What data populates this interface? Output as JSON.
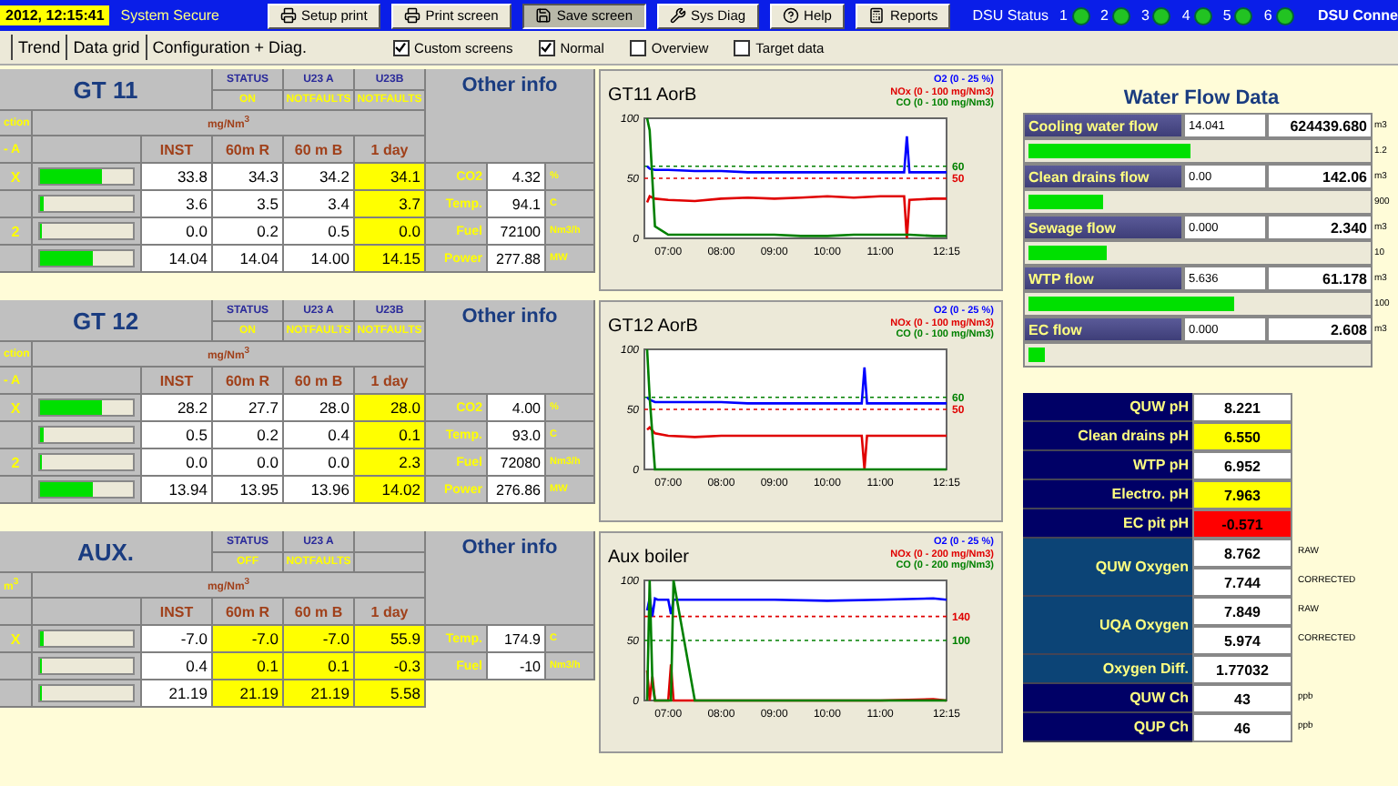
{
  "top_bar": {
    "datetime": "2012, 12:15:41",
    "system_state": "System Secure",
    "buttons": [
      {
        "label": "Setup print",
        "pressed": false
      },
      {
        "label": "Print screen",
        "pressed": false
      },
      {
        "label": "Save screen",
        "pressed": true
      },
      {
        "label": "Sys Diag",
        "pressed": false
      },
      {
        "label": "Help",
        "pressed": false
      },
      {
        "label": "Reports",
        "pressed": false
      }
    ],
    "dsu_status": {
      "label": "DSU Status",
      "units": [
        {
          "number": "1",
          "ok": true
        },
        {
          "number": "2",
          "ok": true
        },
        {
          "number": "3",
          "ok": true
        },
        {
          "number": "4",
          "ok": true
        },
        {
          "number": "5",
          "ok": true
        },
        {
          "number": "6",
          "ok": true
        }
      ]
    },
    "connection": "DSU Conne"
  },
  "tabs": [
    {
      "label": "Trend",
      "selected": false
    },
    {
      "label": "Data grid",
      "selected": false
    },
    {
      "label": "Configuration + Diag.",
      "selected": false
    }
  ],
  "options": [
    {
      "label": "Custom screens",
      "checked": true
    },
    {
      "label": "Normal",
      "checked": true
    },
    {
      "label": "Overview",
      "checked": false
    },
    {
      "label": "Target data",
      "checked": false
    }
  ],
  "blocks": [
    {
      "title": "GT 11",
      "status_columns": [
        {
          "header": "STATUS",
          "value": "ON"
        },
        {
          "header": "U23 A",
          "value": "NOTFAULTS"
        },
        {
          "header": "U23B",
          "value": "NOTFAULTS"
        }
      ],
      "unit_label": "ction",
      "unit": "mg/Nm$^{3}$",
      "columns_label": "- A",
      "columns": [
        "INST",
        "60m R",
        "60 m B",
        "1 day"
      ],
      "rows": [
        {
          "label": "X",
          "level": 0.67,
          "values": [
            {
              "text": "33.8",
              "highlighted": false
            },
            {
              "text": "34.3",
              "highlighted": false
            },
            {
              "text": "34.2",
              "highlighted": false
            },
            {
              "text": "34.1",
              "highlighted": true
            }
          ]
        },
        {
          "level": 0.04,
          "values": [
            {
              "text": "3.6",
              "highlighted": false
            },
            {
              "text": "3.5",
              "highlighted": false
            },
            {
              "text": "3.4",
              "highlighted": false
            },
            {
              "text": "3.7",
              "highlighted": true
            }
          ]
        },
        {
          "label": "2",
          "level": 0.02,
          "values": [
            {
              "text": "0.0",
              "highlighted": false
            },
            {
              "text": "0.2",
              "highlighted": false
            },
            {
              "text": "0.5",
              "highlighted": false
            },
            {
              "text": "0.0",
              "highlighted": true
            }
          ]
        },
        {
          "level": 0.57,
          "values": [
            {
              "text": "14.04",
              "highlighted": false
            },
            {
              "text": "14.04",
              "highlighted": false
            },
            {
              "text": "14.00",
              "highlighted": false
            },
            {
              "text": "14.15",
              "highlighted": true
            }
          ]
        }
      ],
      "other_info": {
        "title": "Other info",
        "items": [
          {
            "label": "CO2",
            "value": "4.32",
            "unit": "%"
          },
          {
            "label": "Temp.",
            "value": "94.1",
            "unit": "C"
          },
          {
            "label": "Fuel",
            "value": "72100",
            "unit": "Nm3/h"
          },
          {
            "label": "Power",
            "value": "277.88",
            "unit": "MW"
          }
        ]
      },
      "chart": {
        "title": "GT11 AorB",
        "chart_data": {
          "type": "line",
          "x": [
            6.6,
            6.65,
            6.75,
            7,
            7.5,
            8,
            8.5,
            9,
            9.5,
            10,
            10.5,
            11,
            11.45,
            11.5,
            11.55,
            12,
            12.25
          ],
          "series": [
            {
              "name": "O2 (0 - 25 %)",
              "color": "#0000ff",
              "values": [
                60,
                58,
                57,
                57,
                56,
                56,
                55,
                55,
                55,
                55,
                55,
                55,
                55,
                85,
                55,
                55,
                55
              ]
            },
            {
              "name": "NOx (0 - 100 mg/Nm3)",
              "color": "#e00000",
              "values": [
                30,
                35,
                33,
                32,
                31,
                33,
                34,
                33,
                34,
                35,
                34,
                35,
                35,
                0,
                32,
                33,
                33
              ]
            },
            {
              "name": "CO (0 - 100 mg/Nm3)",
              "color": "#008000",
              "values": [
                100,
                90,
                10,
                3,
                3,
                3,
                3,
                3,
                2,
                2,
                3,
                3,
                3,
                3,
                3,
                2,
                2
              ]
            }
          ],
          "xlim": [
            6.55,
            12.25
          ],
          "ylim": [
            0,
            100
          ],
          "xticks": [
            {
              "value": 7,
              "label": "07:00"
            },
            {
              "value": 8,
              "label": "08:00"
            },
            {
              "value": 9,
              "label": "09:00"
            },
            {
              "value": 10,
              "label": "10:00"
            },
            {
              "value": 11,
              "label": "11:00"
            },
            {
              "value": 12.25,
              "label": "12:15"
            }
          ],
          "yticks": [
            0,
            50,
            100
          ],
          "ref_lines": [
            {
              "axis": "y",
              "value": 60,
              "color": "#008000"
            },
            {
              "axis": "y",
              "value": 50,
              "color": "#e00000"
            }
          ]
        },
        "limit_labels": [
          "60",
          "50"
        ]
      }
    },
    {
      "title": "GT 12",
      "status_columns": [
        {
          "header": "STATUS",
          "value": "ON"
        },
        {
          "header": "U23 A",
          "value": "NOTFAULTS"
        },
        {
          "header": "U23B",
          "value": "NOTFAULTS"
        }
      ],
      "unit_label": "ction",
      "unit": "mg/Nm$^{3}$",
      "columns_label": "- A",
      "columns": [
        "INST",
        "60m R",
        "60 m B",
        "1 day"
      ],
      "rows": [
        {
          "label": "X",
          "level": 0.67,
          "values": [
            {
              "text": "28.2",
              "highlighted": false
            },
            {
              "text": "27.7",
              "highlighted": false
            },
            {
              "text": "28.0",
              "highlighted": false
            },
            {
              "text": "28.0",
              "highlighted": true
            }
          ]
        },
        {
          "level": 0.04,
          "values": [
            {
              "text": "0.5",
              "highlighted": false
            },
            {
              "text": "0.2",
              "highlighted": false
            },
            {
              "text": "0.4",
              "highlighted": false
            },
            {
              "text": "0.1",
              "highlighted": true
            }
          ]
        },
        {
          "label": "2",
          "level": 0.02,
          "values": [
            {
              "text": "0.0",
              "highlighted": false
            },
            {
              "text": "0.0",
              "highlighted": false
            },
            {
              "text": "0.0",
              "highlighted": false
            },
            {
              "text": "2.3",
              "highlighted": true
            }
          ]
        },
        {
          "level": 0.57,
          "values": [
            {
              "text": "13.94",
              "highlighted": false
            },
            {
              "text": "13.95",
              "highlighted": false
            },
            {
              "text": "13.96",
              "highlighted": false
            },
            {
              "text": "14.02",
              "highlighted": true
            }
          ]
        }
      ],
      "other_info": {
        "title": "Other info",
        "items": [
          {
            "label": "CO2",
            "value": "4.00",
            "unit": "%"
          },
          {
            "label": "Temp.",
            "value": "93.0",
            "unit": "C"
          },
          {
            "label": "Fuel",
            "value": "72080",
            "unit": "Nm3/h"
          },
          {
            "label": "Power",
            "value": "276.86",
            "unit": "MW"
          }
        ]
      },
      "chart": {
        "title": "GT12 AorB",
        "chart_data": {
          "type": "line",
          "x": [
            6.6,
            6.65,
            6.75,
            7,
            7.5,
            8,
            8.5,
            9,
            9.5,
            10,
            10.5,
            10.65,
            10.7,
            10.75,
            11,
            11.5,
            12,
            12.25
          ],
          "series": [
            {
              "name": "O2 (0 - 25 %)",
              "color": "#0000ff",
              "values": [
                60,
                58,
                56,
                56,
                56,
                56,
                55,
                55,
                55,
                55,
                55,
                55,
                85,
                55,
                55,
                55,
                55,
                55
              ]
            },
            {
              "name": "NOx (0 - 100 mg/Nm3)",
              "color": "#e00000",
              "values": [
                33,
                35,
                30,
                28,
                27,
                28,
                28,
                28,
                28,
                28,
                28,
                28,
                0,
                28,
                28,
                28,
                28,
                28
              ]
            },
            {
              "name": "CO (0 - 100 mg/Nm3)",
              "color": "#008000",
              "values": [
                100,
                60,
                0,
                0,
                0,
                0,
                0,
                0,
                0,
                0,
                0,
                0,
                0,
                0,
                0,
                0,
                0,
                0
              ]
            }
          ],
          "xlim": [
            6.55,
            12.25
          ],
          "ylim": [
            0,
            100
          ],
          "xticks": [
            {
              "value": 7,
              "label": "07:00"
            },
            {
              "value": 8,
              "label": "08:00"
            },
            {
              "value": 9,
              "label": "09:00"
            },
            {
              "value": 10,
              "label": "10:00"
            },
            {
              "value": 11,
              "label": "11:00"
            },
            {
              "value": 12.25,
              "label": "12:15"
            }
          ],
          "yticks": [
            0,
            50,
            100
          ],
          "ref_lines": [
            {
              "axis": "y",
              "value": 60,
              "color": "#008000"
            },
            {
              "axis": "y",
              "value": 50,
              "color": "#e00000"
            }
          ]
        },
        "limit_labels": [
          "60",
          "50"
        ]
      }
    },
    {
      "title": "AUX.",
      "status_columns": [
        {
          "header": "STATUS",
          "value": "OFF"
        },
        {
          "header": "U23 A",
          "value": "NOTFAULTS"
        }
      ],
      "unit_label": "m$^{3}$",
      "unit": "mg/Nm$^{3}$",
      "columns": [
        "INST",
        "60m R",
        "60 m B",
        "1 day"
      ],
      "rows": [
        {
          "label": "X",
          "level": 0.04,
          "values": [
            {
              "text": "-7.0",
              "highlighted": false
            },
            {
              "text": "-7.0",
              "highlighted": true
            },
            {
              "text": "-7.0",
              "highlighted": true
            },
            {
              "text": "55.9",
              "highlighted": true
            }
          ]
        },
        {
          "level": 0.02,
          "values": [
            {
              "text": "0.4",
              "highlighted": false
            },
            {
              "text": "0.1",
              "highlighted": true
            },
            {
              "text": "0.1",
              "highlighted": true
            },
            {
              "text": "-0.3",
              "highlighted": true
            }
          ]
        },
        {
          "level": 0.02,
          "values": [
            {
              "text": "21.19",
              "highlighted": false
            },
            {
              "text": "21.19",
              "highlighted": true
            },
            {
              "text": "21.19",
              "highlighted": true
            },
            {
              "text": "5.58",
              "highlighted": true
            }
          ]
        }
      ],
      "other_info": {
        "title": "Other info",
        "items": [
          {
            "label": "Temp.",
            "value": "174.9",
            "unit": "C"
          },
          {
            "label": "Fuel",
            "value": "-10",
            "unit": "Nm3/h"
          }
        ]
      },
      "chart": {
        "title": "Aux boiler",
        "chart_data": {
          "type": "line",
          "x": [
            6.6,
            6.65,
            6.7,
            6.75,
            6.8,
            7,
            7.05,
            7.1,
            7.5,
            8,
            9,
            10,
            11,
            12,
            12.25
          ],
          "series": [
            {
              "name": "O2 (0 - 25 %)",
              "color": "#0000ff",
              "values": [
                75,
                85,
                70,
                85,
                84,
                84,
                72,
                84,
                84,
                84,
                84,
                83,
                84,
                85,
                84
              ]
            },
            {
              "name": "NOx (0 - 200 mg/Nm3)",
              "color": "#e00000",
              "values": [
                25,
                0,
                20,
                0,
                0,
                0,
                30,
                0,
                0,
                0,
                0,
                0,
                0,
                1,
                0
              ]
            },
            {
              "name": "CO (0 - 200 mg/Nm3)",
              "color": "#008000",
              "values": [
                0,
                100,
                15,
                0,
                0,
                0,
                0,
                100,
                0,
                0,
                0,
                0,
                0,
                0,
                0
              ]
            }
          ],
          "xlim": [
            6.55,
            12.25
          ],
          "ylim": [
            0,
            100
          ],
          "xticks": [
            {
              "value": 7,
              "label": "07:00"
            },
            {
              "value": 8,
              "label": "08:00"
            },
            {
              "value": 9,
              "label": "09:00"
            },
            {
              "value": 10,
              "label": "10:00"
            },
            {
              "value": 11,
              "label": "11:00"
            },
            {
              "value": 12.25,
              "label": "12:15"
            }
          ],
          "yticks": [
            0,
            50,
            100
          ],
          "ref_lines": [
            {
              "axis": "y",
              "value": 70,
              "color": "#e00000"
            },
            {
              "axis": "y",
              "value": 50,
              "color": "#008000"
            }
          ]
        },
        "limit_labels": [
          "140",
          "100"
        ]
      }
    }
  ],
  "water_flow": {
    "title": "Water Flow Data",
    "flows": [
      {
        "label": "Cooling water flow",
        "rate": "14.041",
        "total": "624439.680",
        "unit": "m3",
        "level": 0.48,
        "scale": "1.2"
      },
      {
        "label": "Clean drains flow",
        "rate": "0.00",
        "total": "142.06",
        "unit": "m3",
        "level": 0.22,
        "scale": "900"
      },
      {
        "label": "Sewage flow",
        "rate": "0.000",
        "total": "2.340",
        "unit": "m3",
        "level": 0.23,
        "scale": "10"
      },
      {
        "label": "WTP flow",
        "rate": "5.636",
        "total": "61.178",
        "unit": "m3",
        "level": 0.61,
        "scale": "100"
      },
      {
        "label": "EC flow",
        "rate": "0.000",
        "total": "2.608",
        "unit": "m3",
        "level": 0.05
      }
    ]
  },
  "chemistry": [
    {
      "label": "QUW pH",
      "kind": "dark",
      "values": [
        {
          "text": "8.221",
          "color": "#ffffff"
        }
      ]
    },
    {
      "label": "Clean drains pH",
      "kind": "dark",
      "values": [
        {
          "text": "6.550",
          "color": "#ffff00"
        }
      ]
    },
    {
      "label": "WTP pH",
      "kind": "dark",
      "values": [
        {
          "text": "6.952",
          "color": "#ffffff"
        }
      ]
    },
    {
      "label": "Electro. pH",
      "kind": "dark",
      "values": [
        {
          "text": "7.963",
          "color": "#ffff00"
        }
      ]
    },
    {
      "label": "EC pit pH",
      "kind": "dark",
      "values": [
        {
          "text": "-0.571",
          "color": "#ff0000"
        }
      ]
    },
    {
      "label": "QUW Oxygen",
      "kind": "steel",
      "values": [
        {
          "text": "8.762",
          "color": "#ffffff",
          "note": "RAW"
        },
        {
          "text": "7.744",
          "color": "#ffffff",
          "note": "CORRECTED"
        }
      ]
    },
    {
      "label": "UQA Oxygen",
      "kind": "steel",
      "values": [
        {
          "text": "7.849",
          "color": "#ffffff",
          "note": "RAW"
        },
        {
          "text": "5.974",
          "color": "#ffffff",
          "note": "CORRECTED"
        }
      ]
    },
    {
      "label": "Oxygen Diff.",
      "kind": "steel",
      "values": [
        {
          "text": "1.77032",
          "color": "#ffffff"
        }
      ]
    },
    {
      "label": "QUW Ch",
      "kind": "dark",
      "values": [
        {
          "text": "43",
          "color": "#ffffff",
          "note": "ppb"
        }
      ]
    },
    {
      "label": "QUP Ch",
      "kind": "dark",
      "values": [
        {
          "text": "46",
          "color": "#ffffff",
          "note": "ppb"
        }
      ]
    }
  ]
}
